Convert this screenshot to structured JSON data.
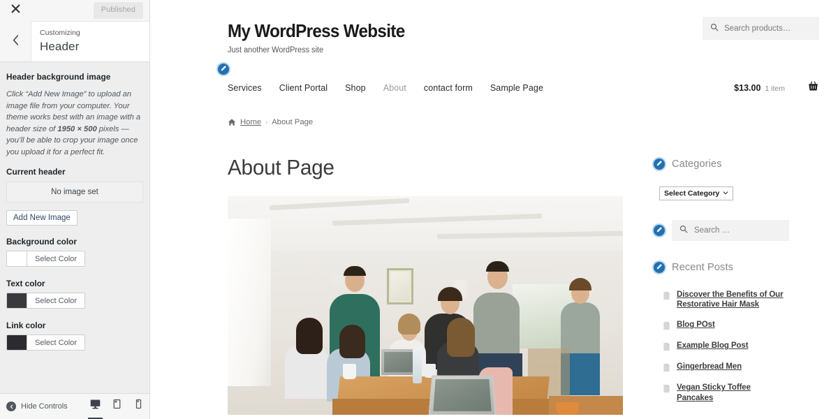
{
  "customizer": {
    "topbar": {
      "close_icon": "close-icon",
      "published_label": "Published"
    },
    "panel": {
      "back_icon": "chevron-left-icon",
      "eyebrow": "Customizing",
      "title": "Header"
    },
    "section": {
      "title": "Header background image",
      "description_pre": "Click “Add New Image” to upload an image file from your computer. Your theme works best with an image with a header size of ",
      "description_bold": "1950 × 500",
      "description_post": " pixels — you’ll be able to crop your image once you upload it for a perfect fit.",
      "current_header_label": "Current header",
      "no_image_text": "No image set",
      "add_button": "Add New Image"
    },
    "colors": [
      {
        "label": "Background color",
        "button": "Select Color",
        "swatch": "#ffffff"
      },
      {
        "label": "Text color",
        "button": "Select Color",
        "swatch": "#3a3a3e"
      },
      {
        "label": "Link color",
        "button": "Select Color",
        "swatch": "#2c2c30"
      }
    ],
    "footer": {
      "hide_controls": "Hide Controls",
      "devices": [
        {
          "name": "desktop",
          "active": true
        },
        {
          "name": "tablet",
          "active": false
        },
        {
          "name": "mobile",
          "active": false
        }
      ]
    }
  },
  "preview": {
    "site": {
      "title": "My WordPress Website",
      "tagline": "Just another WordPress site",
      "product_search_placeholder": "Search products…"
    },
    "nav": [
      {
        "label": "Services",
        "muted": false
      },
      {
        "label": "Client Portal",
        "muted": false
      },
      {
        "label": "Shop",
        "muted": false
      },
      {
        "label": "About",
        "muted": true
      },
      {
        "label": "contact form",
        "muted": false
      },
      {
        "label": "Sample Page",
        "muted": false
      }
    ],
    "cart": {
      "price": "$13.00",
      "count": "1 item",
      "icon": "shopping-basket-icon"
    },
    "breadcrumb": {
      "home_icon": "home-icon",
      "home": "Home",
      "separator": "›",
      "current": "About Page"
    },
    "page": {
      "title": "About Page",
      "hero_alt": "team working in bright room"
    },
    "widgets": {
      "categories": {
        "title": "Categories",
        "select_value": "Select Category"
      },
      "search": {
        "title": "Search",
        "placeholder": "Search …"
      },
      "recent_posts": {
        "title": "Recent Posts",
        "items": [
          "Discover the Benefits of Our Restorative Hair Mask",
          "Blog POst",
          "Example Blog Post",
          "Gingerbread Men",
          "Vegan Sticky Toffee Pancakes"
        ]
      }
    },
    "accent_color": "#2271b1"
  }
}
